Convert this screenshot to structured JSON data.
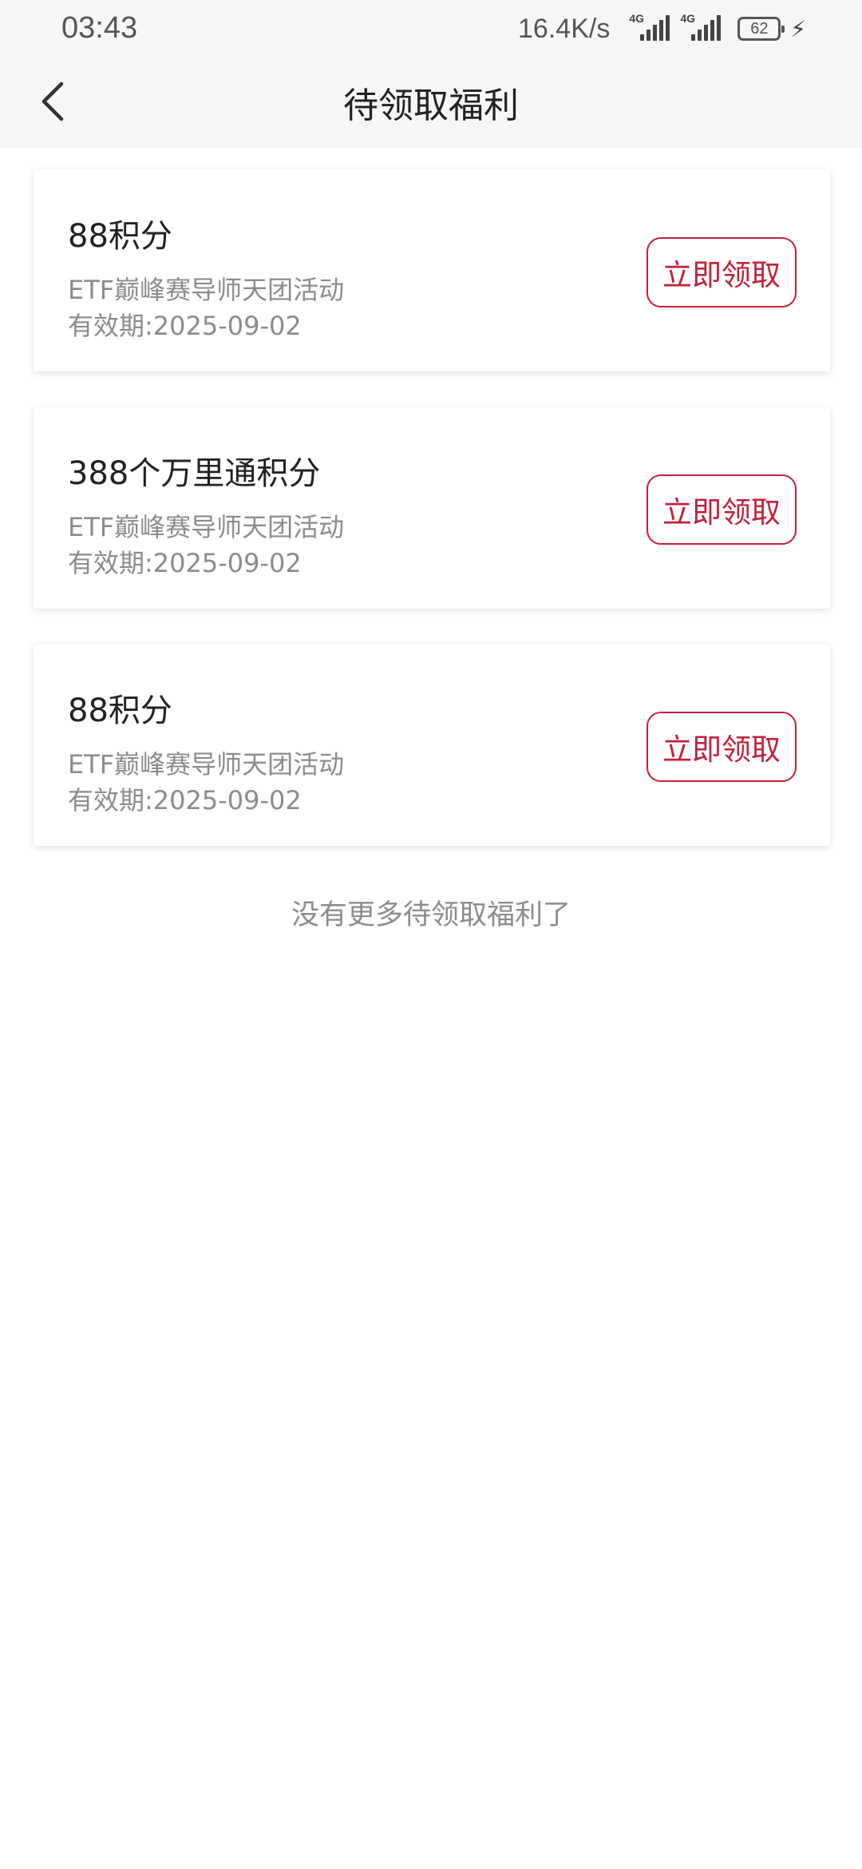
{
  "status_bar": {
    "time": "03:43",
    "net_speed": "16.4K/s",
    "signal_1_tag": "4G",
    "signal_2_tag": "4G",
    "battery": "62"
  },
  "header": {
    "back_icon": "chevron-left-icon",
    "title": "待领取福利"
  },
  "benefits": [
    {
      "title": "88积分",
      "source": "ETF巅峰赛导师天团活动",
      "validity": "有效期:2025-09-02",
      "button_label": "立即领取"
    },
    {
      "title": "388个万里通积分",
      "source": "ETF巅峰赛导师天团活动",
      "validity": "有效期:2025-09-02",
      "button_label": "立即领取"
    },
    {
      "title": "88积分",
      "source": "ETF巅峰赛导师天团活动",
      "validity": "有效期:2025-09-02",
      "button_label": "立即领取"
    }
  ],
  "end_note": "没有更多待领取福利了",
  "colors": {
    "accent": "#c3203a",
    "header_bg": "#f6f6f6",
    "secondary_text": "#8c8c8c"
  }
}
